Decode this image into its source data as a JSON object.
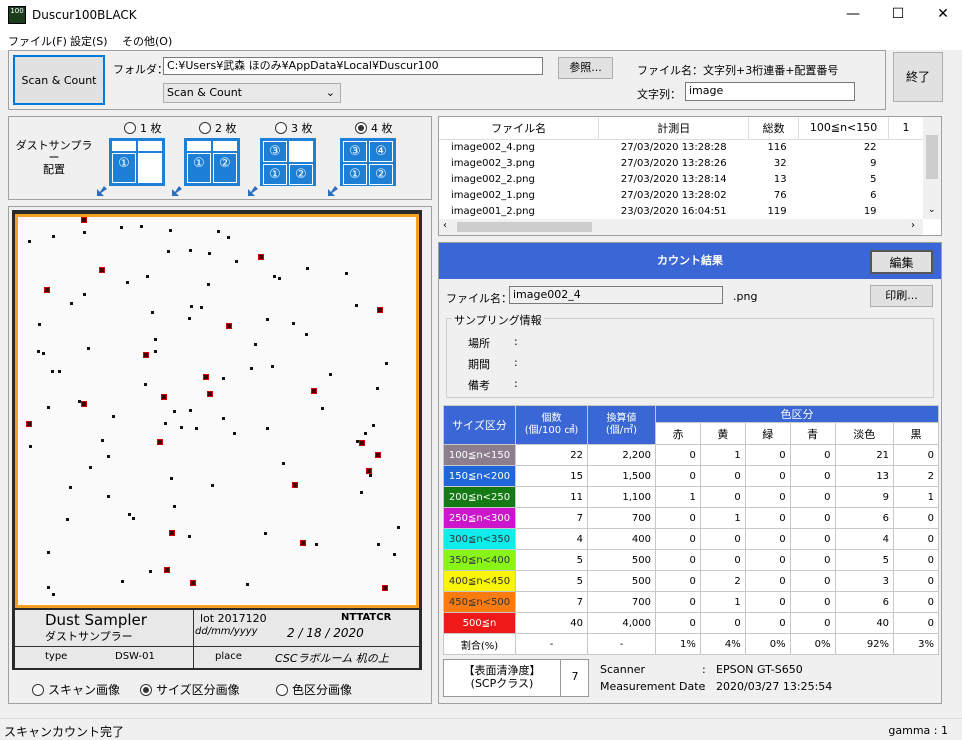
{
  "window": {
    "title": "Duscur100BLACK",
    "icon_text": "100"
  },
  "controls": {
    "minimize": "—",
    "maximize": "☐",
    "close": "✕"
  },
  "menu": [
    {
      "label": "ファイル(F)"
    },
    {
      "label": "設定(S)"
    },
    {
      "label": "その他(O)"
    }
  ],
  "toolbar": {
    "scan_count_button": "Scan & Count",
    "folder_label": "フォルダ：",
    "folder_path": "C:¥Users¥武森 ほのみ¥AppData¥Local¥Duscur100",
    "browse_button": "参照...",
    "mode_select": "Scan & Count",
    "filename_rule": "ファイル名：文字列+3桁連番+配置番号",
    "string_label": "文字列：",
    "string_value": "image",
    "exit_button": "終了"
  },
  "sampler_layout": {
    "label_line1": "ダストサンプラー",
    "label_line2": "配置",
    "options": [
      {
        "label": "1 枚",
        "selected": false
      },
      {
        "label": "2 枚",
        "selected": false
      },
      {
        "label": "3 枚",
        "selected": false
      },
      {
        "label": "4 枚",
        "selected": true
      }
    ],
    "icons": [
      [
        "",
        "",
        "①",
        ""
      ],
      [
        "",
        "",
        "①",
        "②"
      ],
      [
        "③",
        "",
        "①",
        "②"
      ],
      [
        "③",
        "④",
        "①",
        "②"
      ]
    ]
  },
  "file_list": {
    "headers": [
      "ファイル名",
      "計測日",
      "総数",
      "100≦n<150",
      "1"
    ],
    "rows": [
      [
        "image002_4.png",
        "27/03/2020 13:28:28",
        "116",
        "22"
      ],
      [
        "image002_3.png",
        "27/03/2020 13:28:26",
        "32",
        "9"
      ],
      [
        "image002_2.png",
        "27/03/2020 13:28:14",
        "13",
        "5"
      ],
      [
        "image002_1.png",
        "27/03/2020 13:28:02",
        "76",
        "6"
      ],
      [
        "image001_2.png",
        "23/03/2020 16:04:51",
        "119",
        "19"
      ]
    ]
  },
  "image_panel": {
    "sampler_title": "Dust Sampler",
    "sampler_title_jp": "ダストサンプラー",
    "lot": "lot 2017120",
    "brand": "NTTATCR",
    "date_format": "dd/mm/yyyy",
    "date_written": "2 / 18 / 2020",
    "type_label": "type",
    "type_value": "DSW-01",
    "place_label": "place",
    "place_value": "CSCラボルーム 机の上",
    "view_options": [
      {
        "label": "スキャン画像",
        "selected": false
      },
      {
        "label": "サイズ区分画像",
        "selected": true
      },
      {
        "label": "色区分画像",
        "selected": false
      }
    ]
  },
  "result": {
    "header": "カウント結果",
    "edit_button": "編集",
    "filename_label": "ファイル名：",
    "filename_value": "image002_4",
    "ext": ".png",
    "print_button": "印刷...",
    "sampling_title": "サンプリング情報",
    "place_label": "場所",
    "period_label": "期間",
    "note_label": "備考",
    "colon": ":",
    "table_headers": {
      "size": "サイズ区分",
      "count": "個数\n(個/100 ㎠)",
      "converted": "換算値\n(個/㎡)",
      "color_group": "色区分",
      "colors": [
        "赤",
        "黄",
        "緑",
        "青",
        "淡色",
        "黒"
      ]
    },
    "rows": [
      {
        "label": "100≦n<150",
        "color": "#8c7e8c",
        "text": "#fff",
        "count": "22",
        "conv": "2,200",
        "c": [
          "0",
          "1",
          "0",
          "0",
          "21",
          "0"
        ]
      },
      {
        "label": "150≦n<200",
        "color": "#1f66d8",
        "text": "#fff",
        "count": "15",
        "conv": "1,500",
        "c": [
          "0",
          "0",
          "0",
          "0",
          "13",
          "2"
        ]
      },
      {
        "label": "200≦n<250",
        "color": "#147a14",
        "text": "#fff",
        "count": "11",
        "conv": "1,100",
        "c": [
          "1",
          "0",
          "0",
          "0",
          "9",
          "1"
        ]
      },
      {
        "label": "250≦n<300",
        "color": "#cc16cc",
        "text": "#fff",
        "count": "7",
        "conv": "700",
        "c": [
          "0",
          "1",
          "0",
          "0",
          "6",
          "0"
        ]
      },
      {
        "label": "300≦n<350",
        "color": "#10ecec",
        "text": "#333",
        "count": "4",
        "conv": "400",
        "c": [
          "0",
          "0",
          "0",
          "0",
          "4",
          "0"
        ]
      },
      {
        "label": "350≦n<400",
        "color": "#88f418",
        "text": "#333",
        "count": "5",
        "conv": "500",
        "c": [
          "0",
          "0",
          "0",
          "0",
          "5",
          "0"
        ]
      },
      {
        "label": "400≦n<450",
        "color": "#f8f40a",
        "text": "#333",
        "count": "5",
        "conv": "500",
        "c": [
          "0",
          "2",
          "0",
          "0",
          "3",
          "0"
        ]
      },
      {
        "label": "450≦n<500",
        "color": "#fa7b10",
        "text": "#333",
        "count": "7",
        "conv": "700",
        "c": [
          "0",
          "1",
          "0",
          "0",
          "6",
          "0"
        ]
      },
      {
        "label": "500≦n",
        "color": "#f01818",
        "text": "#fff",
        "count": "40",
        "conv": "4,000",
        "c": [
          "0",
          "0",
          "0",
          "0",
          "40",
          "0"
        ]
      }
    ],
    "ratio_row": {
      "label": "割合(%)",
      "count": "-",
      "conv": "-",
      "c": [
        "1%",
        "4%",
        "0%",
        "0%",
        "92%",
        "3%"
      ]
    },
    "cleanliness_label1": "【表面清浄度】",
    "cleanliness_label2": "(SCPクラス)",
    "cleanliness_value": "7",
    "scanner_label": "Scanner",
    "scanner_value": "EPSON GT-S650",
    "measure_label": "Measurement Date",
    "measure_value": "2020/03/27  13:25:54"
  },
  "status": {
    "left": "スキャンカウント完了",
    "right": "gamma : 1"
  }
}
